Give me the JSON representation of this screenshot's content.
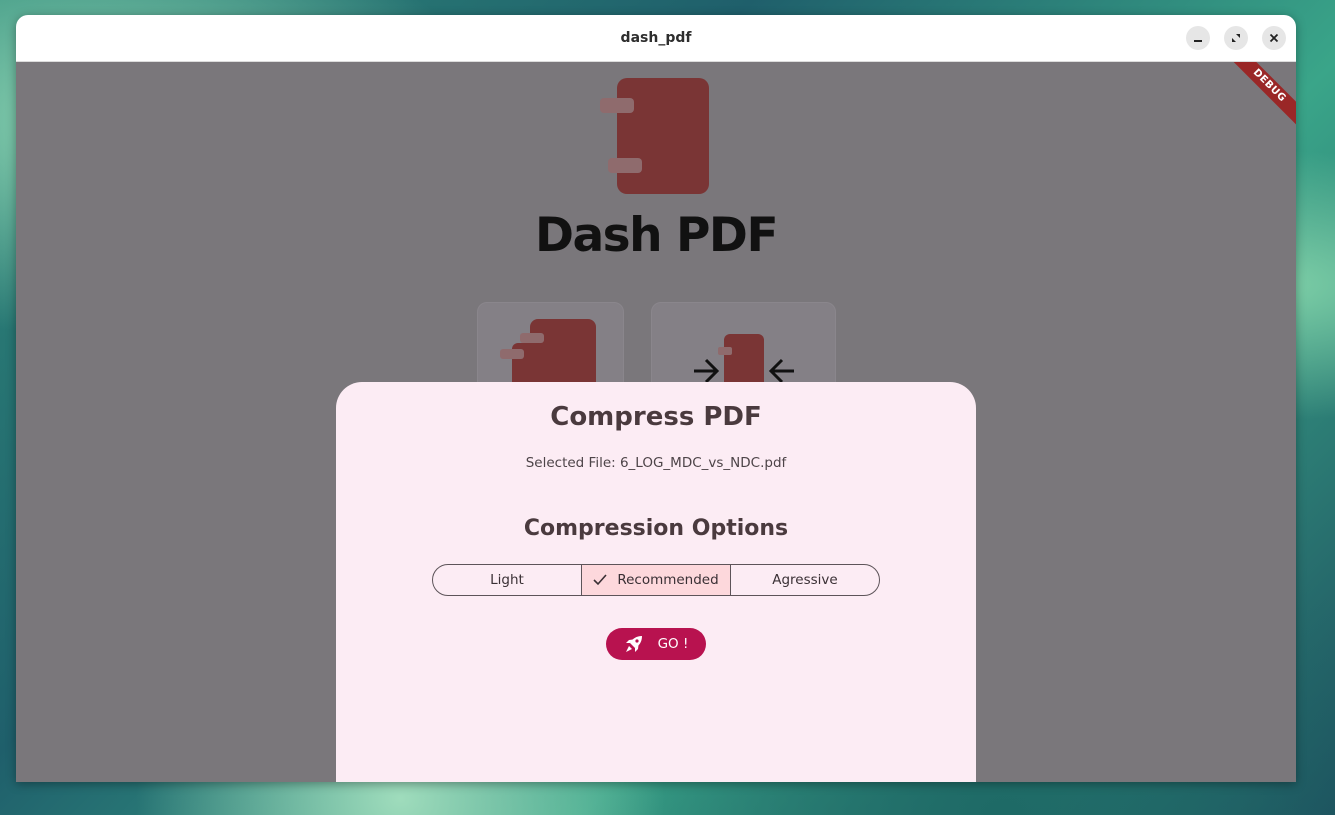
{
  "window": {
    "title": "dash_pdf",
    "controls": [
      "minimize",
      "maximize",
      "close"
    ]
  },
  "debug_banner": "DEBUG",
  "app": {
    "title": "Dash PDF",
    "tools": [
      "pdf-merge-icon",
      "pdf-compress-icon"
    ]
  },
  "dialog": {
    "title": "Compress PDF",
    "selected_file": "Selected File: 6_LOG_MDC_vs_NDC.pdf",
    "options_title": "Compression Options",
    "options": [
      {
        "label": "Light",
        "selected": false
      },
      {
        "label": "Recommended",
        "selected": true
      },
      {
        "label": "Agressive",
        "selected": false
      }
    ],
    "go_label": "GO !",
    "go_icon": "rocket-icon"
  },
  "colors": {
    "accent": "#b8124f",
    "selected_segment": "#fdd8dc",
    "sheet_bg": "#fcecf4",
    "logo_red": "#7a3535"
  }
}
